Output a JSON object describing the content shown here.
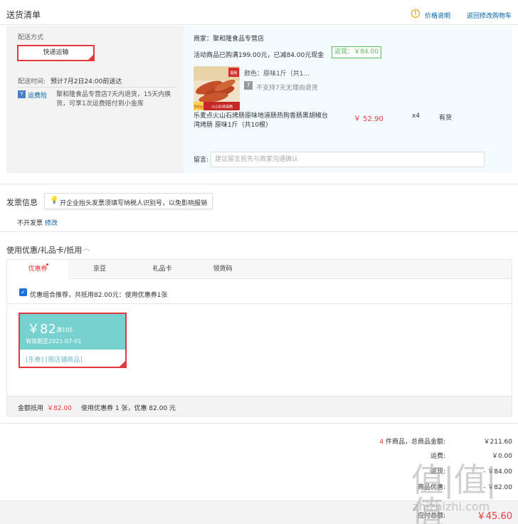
{
  "header": {
    "title": "送货清单",
    "price_explain": "价格说明",
    "back_cart": "返回修改购物车"
  },
  "delivery": {
    "method_label": "配送方式",
    "method_value": "快递运输",
    "time_label": "配送时间:",
    "time_value": "预计7月2日24:00前送达",
    "insurance_icon": "Y",
    "insurance_link": "运费险",
    "insurance_text": "聚和隆食品专营店7天内退货，15天内换货，可享1次运费赔付到小金库"
  },
  "shop": {
    "name": "商家：聚和隆食品专营店",
    "promo": "活动商品已购满199.00元，已减84.00元现金",
    "cashback": "返现：￥84.00"
  },
  "product": {
    "image_badge": "火山石地道肠",
    "image_weight": "500g",
    "image_tag": "烟熏",
    "color": "颜色：原味1斤（共1...",
    "no_return": "不支持7天无理由退货",
    "title": "乐麦点火山石烤肠原味地道肠热狗香肠黑胡椒台湾烤肠 原味1斤（共10根）",
    "price": "￥ 52.90",
    "qty": "x4",
    "stock": "有货"
  },
  "message": {
    "label": "留言:",
    "placeholder": "建议留言前先与商家沟通确认"
  },
  "invoice": {
    "title": "发票信息",
    "tip": "开企业抬头发票须填写纳税人识别号，以免影响报销",
    "value": "不开发票",
    "edit": "修改"
  },
  "coupons": {
    "title": "使用优惠/礼品卡/抵用",
    "tabs": [
      "优惠券",
      "京豆",
      "礼品卡",
      "领货码"
    ],
    "combo_text": "优惠组合推荐，共抵用82.00元：使用优惠券1张",
    "card": {
      "amount": "￥82",
      "condition": "满105",
      "expiry": "有效期至2021-07-01",
      "tags": "[东券] [限店铺商品]"
    },
    "summary_label": "金额抵用",
    "summary_amount": "￥82.00",
    "summary_text": "使用优惠券 1 张，优惠 82.00 元"
  },
  "totals": {
    "goods_count": "4",
    "goods_label": "件商品，总商品金额:",
    "goods_value": "￥211.60",
    "freight_label": "运费:",
    "freight_value": "￥0.00",
    "cashback_label": "返现:",
    "cashback_value": "- ￥84.00",
    "coupon_label": "商品优惠:",
    "coupon_value": "- ￥82.00",
    "grand_label": "应付总额:",
    "grand_value": "￥45.60"
  },
  "watermark": {
    "big": "值|值|值",
    "small": "zhizhizhi.com"
  },
  "colors": {
    "accent_red": "#e4393c",
    "link_blue": "#005ea7",
    "coupon_teal": "#76d1cf",
    "cashback_green": "#5cb85c"
  }
}
